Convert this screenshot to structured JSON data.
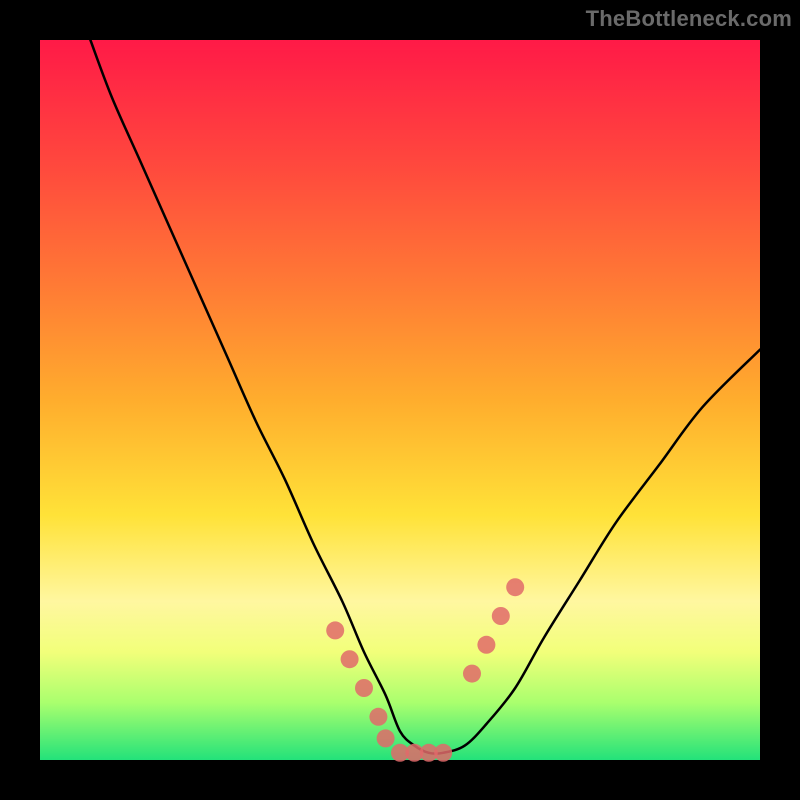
{
  "watermark": "TheBottleneck.com",
  "chart_data": {
    "type": "line",
    "title": "",
    "xlabel": "",
    "ylabel": "",
    "xlim": [
      0,
      100
    ],
    "ylim": [
      0,
      100
    ],
    "grid": false,
    "legend": false,
    "series": [
      {
        "name": "curve",
        "color": "#000000",
        "x": [
          7,
          10,
          14,
          18,
          22,
          26,
          30,
          34,
          38,
          42,
          45,
          48,
          50,
          52,
          54,
          56,
          59,
          62,
          66,
          70,
          75,
          80,
          86,
          92,
          100
        ],
        "y": [
          100,
          92,
          83,
          74,
          65,
          56,
          47,
          39,
          30,
          22,
          15,
          9,
          4,
          2,
          1,
          1,
          2,
          5,
          10,
          17,
          25,
          33,
          41,
          49,
          57
        ]
      }
    ],
    "markers": [
      {
        "name": "marker-cluster-left",
        "color": "#e06a6a",
        "x": [
          41,
          43,
          45,
          47,
          48,
          50,
          52,
          54,
          56
        ],
        "y": [
          18,
          14,
          10,
          6,
          3,
          1,
          1,
          1,
          1
        ]
      },
      {
        "name": "marker-cluster-right",
        "color": "#e06a6a",
        "x": [
          60,
          62,
          64,
          66
        ],
        "y": [
          12,
          16,
          20,
          24
        ]
      }
    ]
  }
}
